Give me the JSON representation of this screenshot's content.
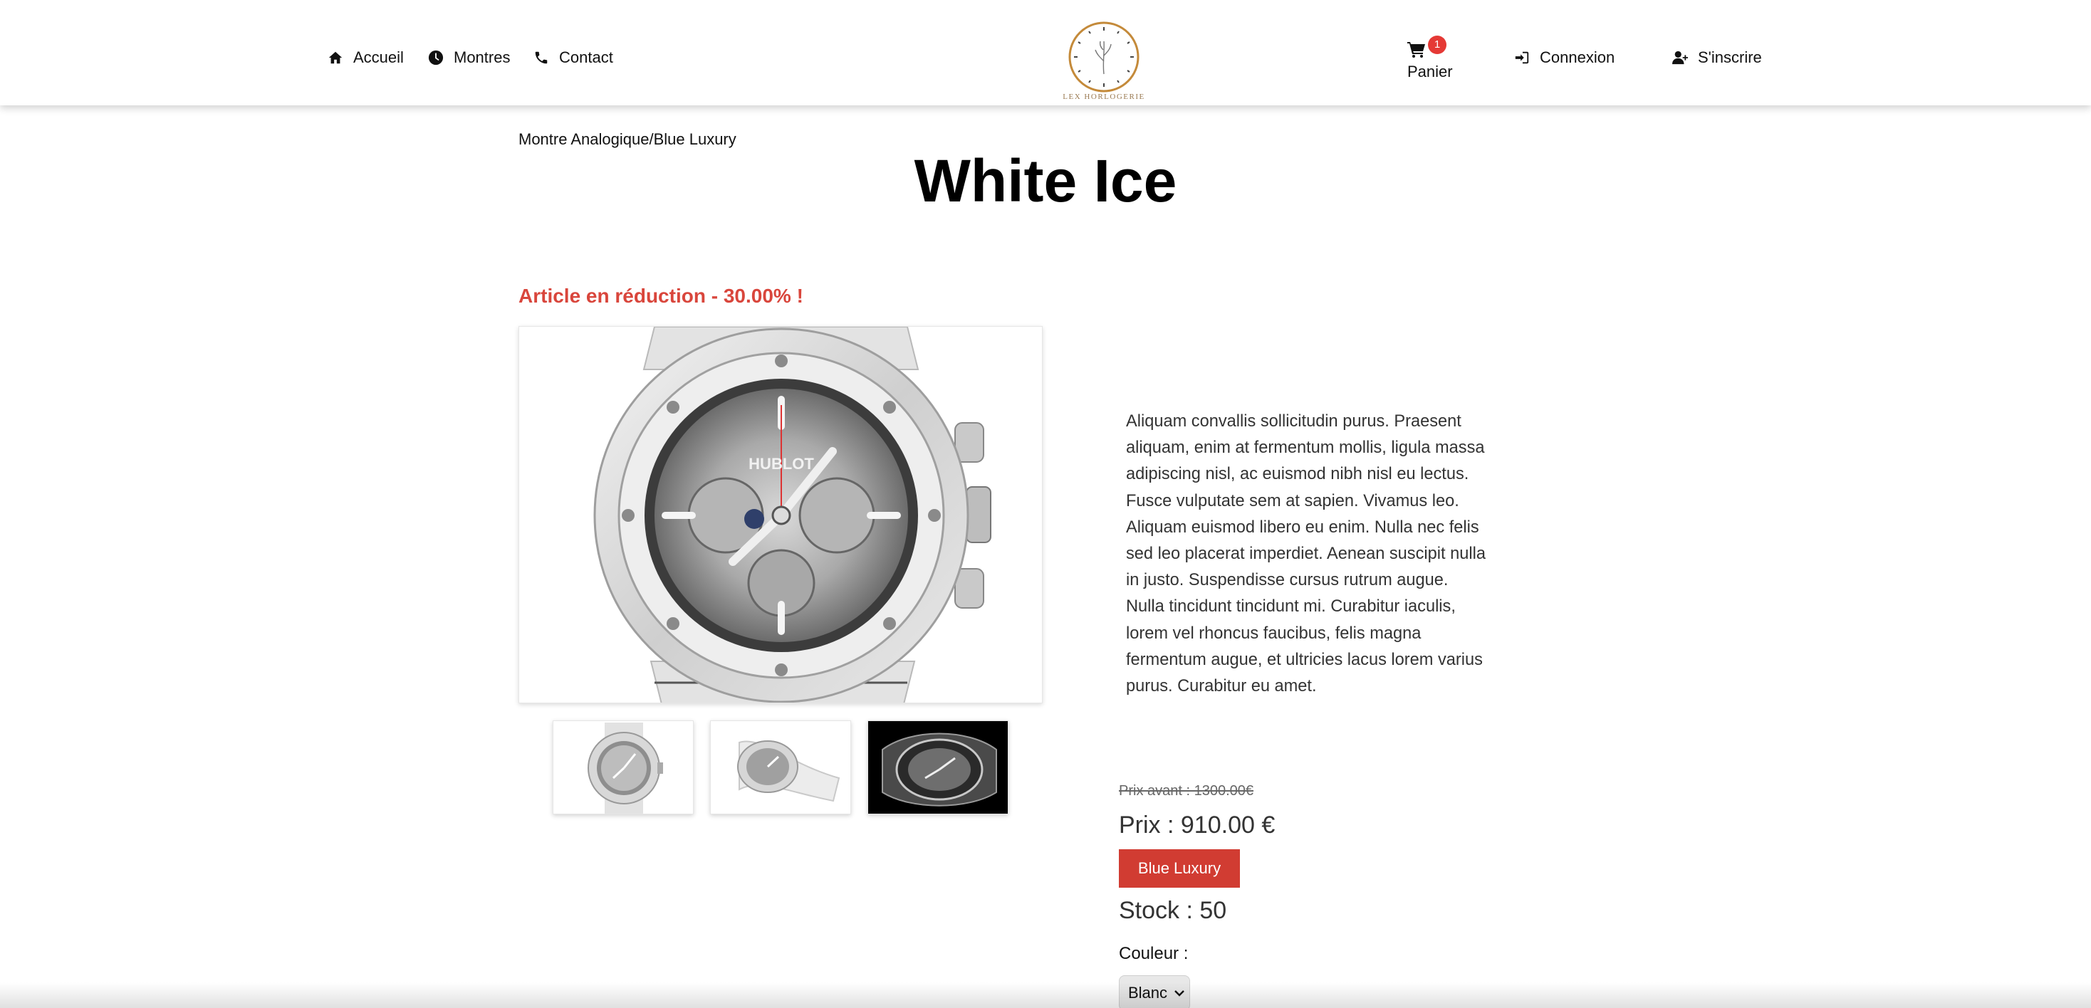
{
  "header": {
    "nav": [
      {
        "label": "Accueil",
        "icon": "home-icon"
      },
      {
        "label": "Montres",
        "icon": "clock-icon"
      },
      {
        "label": "Contact",
        "icon": "phone-icon"
      }
    ],
    "logo_text": "LEX HORLOGERIE",
    "cart": {
      "label": "Panier",
      "count": "1"
    },
    "login_label": "Connexion",
    "signup_label": "S'inscrire"
  },
  "breadcrumb": "Montre Analogique/Blue Luxury",
  "product": {
    "title": "White Ice",
    "promo": "Article en réduction - 30.00% !",
    "description": "Aliquam convallis sollicitudin purus. Praesent aliquam, enim at fermentum mollis, ligula massa adipiscing nisl, ac euismod nibh nisl eu lectus. Fusce vulputate sem at sapien. Vivamus leo. Aliquam euismod libero eu enim. Nulla nec felis sed leo placerat imperdiet. Aenean suscipit nulla in justo. Suspendisse cursus rutrum augue. Nulla tincidunt tincidunt mi. Curabitur iaculis, lorem vel rhoncus faucibus, felis magna fermentum augue, et ultricies lacus lorem varius purus. Curabitur eu amet.",
    "old_price": "Prix avant : 1300.00€",
    "price": "Prix : 910.00 €",
    "brand": "Blue Luxury",
    "stock": "Stock : 50",
    "color_label": "Couleur :",
    "color_selected": "Blanc",
    "watch_brand": "HUBLOT"
  },
  "colors": {
    "accent_red": "#d13c32",
    "promo_red": "#d9463c",
    "badge_red": "#e53935"
  }
}
